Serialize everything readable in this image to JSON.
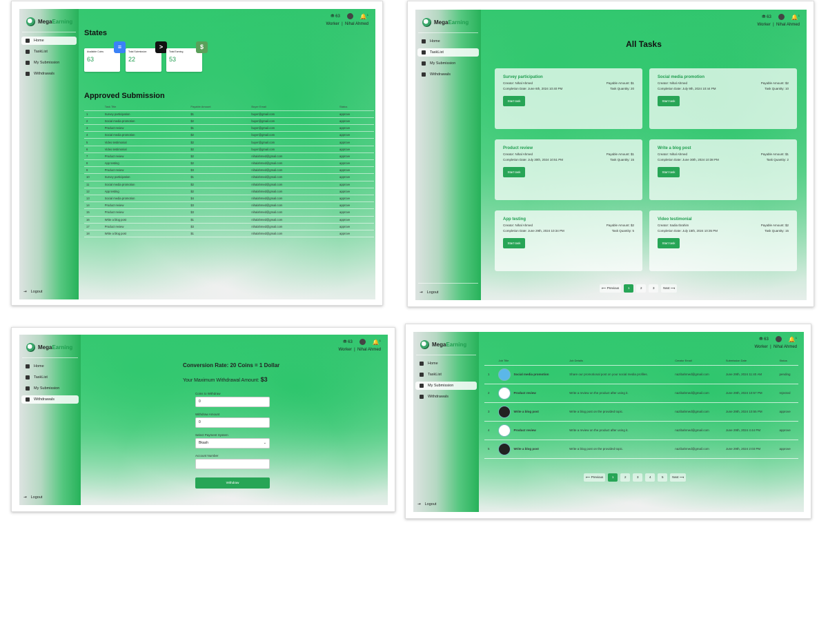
{
  "brand": {
    "mega": "Mega",
    "earning": "Earning"
  },
  "nav": {
    "home": "Home",
    "tasklist": "TaskList",
    "submission": "My Submission",
    "withdrawals": "Withdrawals",
    "logout": "Logout"
  },
  "user": {
    "coins": "63",
    "role": "Worker",
    "separator": "|",
    "name": "Nihal Ahmed",
    "notif_count": "1"
  },
  "dashboard": {
    "states_title": "States",
    "cards": [
      {
        "label": "Available Coins",
        "value": "63"
      },
      {
        "label": "Total Submission",
        "value": "22"
      },
      {
        "label": "Total Earning",
        "value": "53"
      }
    ],
    "approved_title": "Approved Submission",
    "columns": [
      "",
      "Task Title",
      "Payable Amount",
      "Buyer Email",
      "Status"
    ],
    "rows": [
      [
        "1",
        "Survey participation",
        "$1",
        "buyer@gmail.com",
        "approve"
      ],
      [
        "2",
        "Social media promotion",
        "$2",
        "buyer@gmail.com",
        "approve"
      ],
      [
        "3",
        "Product review",
        "$1",
        "buyer@gmail.com",
        "approve"
      ],
      [
        "4",
        "Social media promotion",
        "$2",
        "buyer@gmail.com",
        "approve"
      ],
      [
        "5",
        "Video testimonial",
        "$2",
        "buyer@gmail.com",
        "approve"
      ],
      [
        "6",
        "Video testimonial",
        "$2",
        "buyer@gmail.com",
        "approve"
      ],
      [
        "7",
        "Product review",
        "$2",
        "nihalahmed@gmail.com",
        "approve"
      ],
      [
        "8",
        "App testing",
        "$2",
        "nihalahmed@gmail.com",
        "approve"
      ],
      [
        "9",
        "Product review",
        "$3",
        "nihalahmed@gmail.com",
        "approve"
      ],
      [
        "10",
        "Survey participation",
        "$1",
        "nihalahmed@gmail.com",
        "approve"
      ],
      [
        "11",
        "Social media promotion",
        "$2",
        "nihalahmed@gmail.com",
        "approve"
      ],
      [
        "12",
        "App testing",
        "$2",
        "nihalahmed@gmail.com",
        "approve"
      ],
      [
        "13",
        "Social media promotion",
        "$4",
        "nihalahmed@gmail.com",
        "approve"
      ],
      [
        "14",
        "Product review",
        "$3",
        "nihalahmed@gmail.com",
        "approve"
      ],
      [
        "15",
        "Product review",
        "$3",
        "nihalahmed@gmail.com",
        "approve"
      ],
      [
        "16",
        "Write a blog post",
        "$1",
        "nihalahmed@gmail.com",
        "approve"
      ],
      [
        "17",
        "Product review",
        "$3",
        "nihalahmed@gmail.com",
        "approve"
      ],
      [
        "18",
        "Write a blog post",
        "$1",
        "nihalahmed@gmail.com",
        "approve"
      ]
    ]
  },
  "tasks": {
    "title": "All Tasks",
    "cards": [
      {
        "title": "Survey participation",
        "creator": "Creator: Nihal Ahmed",
        "amount": "Payable Amount: $1",
        "date": "Completion Date: June 6th, 2024 10:40 PM",
        "qty": "Task Quantity: 20",
        "btn": "Start task"
      },
      {
        "title": "Social media promotion",
        "creator": "Creator: Nihal Ahmed",
        "amount": "Payable Amount: $2",
        "date": "Completion Date: July 9th, 2024 10:44 PM",
        "qty": "Task Quantity: 10",
        "btn": "Start task"
      },
      {
        "title": "Product review",
        "creator": "Creator: Nihal Ahmed",
        "amount": "Payable Amount: $1",
        "date": "Completion Date: July 30th, 2024 10:51 PM",
        "qty": "Task Quantity: 15",
        "btn": "Start task"
      },
      {
        "title": "Write a blog post",
        "creator": "Creator: Nihal Ahmed",
        "amount": "Payable Amount: $1",
        "date": "Completion Date: June 30th, 2024 10:38 PM",
        "qty": "Task Quantity: 2",
        "btn": "Start task"
      },
      {
        "title": "App testing",
        "creator": "Creator: Nihal Ahmed",
        "amount": "Payable Amount: $2",
        "date": "Completion Date: June 29th, 2024 10:34 PM",
        "qty": "Task Quantity: 5",
        "btn": "Start task"
      },
      {
        "title": "Video testimonial",
        "creator": "Creator: Sadia Ibrahim",
        "amount": "Payable Amount: $2",
        "date": "Completion Date: July 15th, 2024 10:35 PM",
        "qty": "Task Quantity: 15",
        "btn": "Start task"
      }
    ],
    "pager": {
      "prev": "Previous",
      "pages": [
        "1",
        "2",
        "3"
      ],
      "next": "Next"
    }
  },
  "withdraw": {
    "rate": "Conversion Rate: 20 Coins = 1 Dollar",
    "max_label": "Your Maximum Withdrawal Amount:",
    "max_value": "$3",
    "fields": [
      {
        "label": "Coins to Withdraw",
        "value": "0"
      },
      {
        "label": "Withdraw Amount",
        "value": "0"
      },
      {
        "label": "Select Payment System",
        "value": "Bkash"
      },
      {
        "label": "Account Number",
        "value": ""
      }
    ],
    "button": "Withdraw"
  },
  "submissions": {
    "columns": [
      "",
      "Job Title",
      "Job Details",
      "Creator Email",
      "Submission Date",
      "Status"
    ],
    "rows": [
      [
        "1",
        "Social media promotion",
        "Share our promotional post on your social media profiles.",
        "nazibahmed@gmail.com",
        "June 29th, 2024 11:40 AM",
        "pending"
      ],
      [
        "2",
        "Product review",
        "Write a review on the product after using it.",
        "nazibahmed@gmail.com",
        "June 29th, 2024 10:57 PM",
        "rejected"
      ],
      [
        "3",
        "Write a blog post",
        "Write a blog post on the provided topic.",
        "nazibahmed@gmail.com",
        "June 29th, 2024 10:55 PM",
        "approve"
      ],
      [
        "4",
        "Product review",
        "Write a review on the product after using it.",
        "nazibahmed@gmail.com",
        "June 29th, 2024 4:44 PM",
        "approve"
      ],
      [
        "5",
        "Write a blog post",
        "Write a blog post on the provided topic.",
        "nazibahmed@gmail.com",
        "June 29th, 2024 2:03 PM",
        "approve"
      ]
    ],
    "pager": {
      "prev": "Previous",
      "pages": [
        "1",
        "2",
        "3",
        "4",
        "5"
      ],
      "next": "Next"
    }
  },
  "colors": {
    "accent": "#27a556",
    "title_green": "#1f9d4f",
    "card_icon_1": "#3b82f6",
    "card_icon_2": "#111111",
    "card_icon_3": "#5aa05a"
  }
}
